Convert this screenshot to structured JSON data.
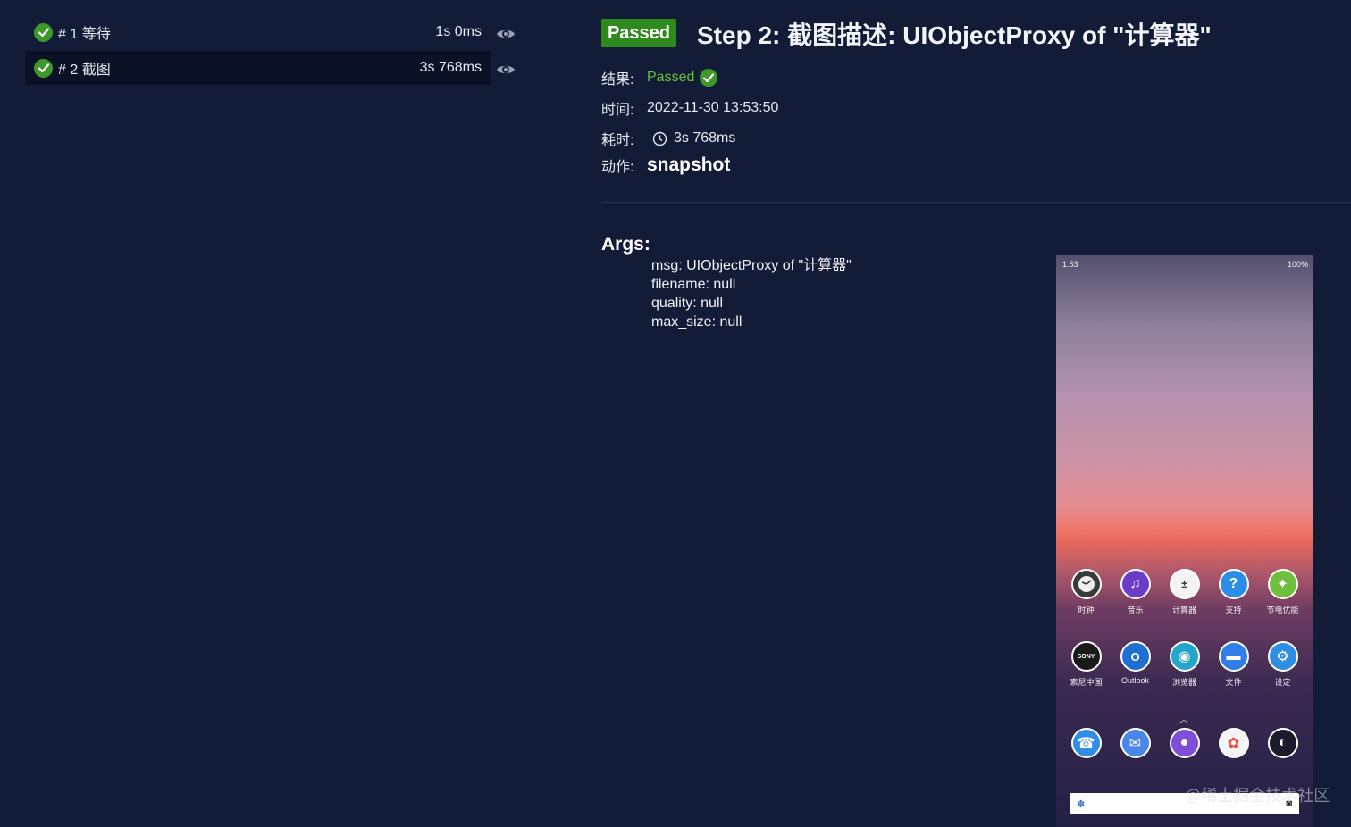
{
  "steps": [
    {
      "label": "# 1 等待",
      "duration": "1s 0ms"
    },
    {
      "label": "# 2 截图",
      "duration": "3s 768ms"
    }
  ],
  "detail": {
    "badge": "Passed",
    "title": "Step 2: 截图描述: UIObjectProxy of \"计算器\"",
    "result_key": "结果:",
    "result_val": "Passed",
    "time_key": "时间:",
    "time_val": "2022-11-30 13:53:50",
    "duration_key": "耗时:",
    "duration_val": "3s 768ms",
    "action_key": "动作:",
    "action_val": "snapshot"
  },
  "args": {
    "title": "Args:",
    "items": [
      "msg: UIObjectProxy of \"计算器\"",
      "filename: null",
      "quality: null",
      "max_size: null"
    ]
  },
  "phone": {
    "status_left": "1:53",
    "status_right": "100%",
    "row1": [
      "时钟",
      "音乐",
      "计算器",
      "支持",
      "节电优能"
    ],
    "row2": [
      "索尼中国",
      "Outlook",
      "浏览器",
      "文件",
      "设定"
    ],
    "sony_text": "SONY"
  },
  "watermark": "@稀土掘金技术社区",
  "colors": {
    "background": "#131c36",
    "passed_green": "#2e8a1f",
    "passed_text": "#67c23a"
  }
}
